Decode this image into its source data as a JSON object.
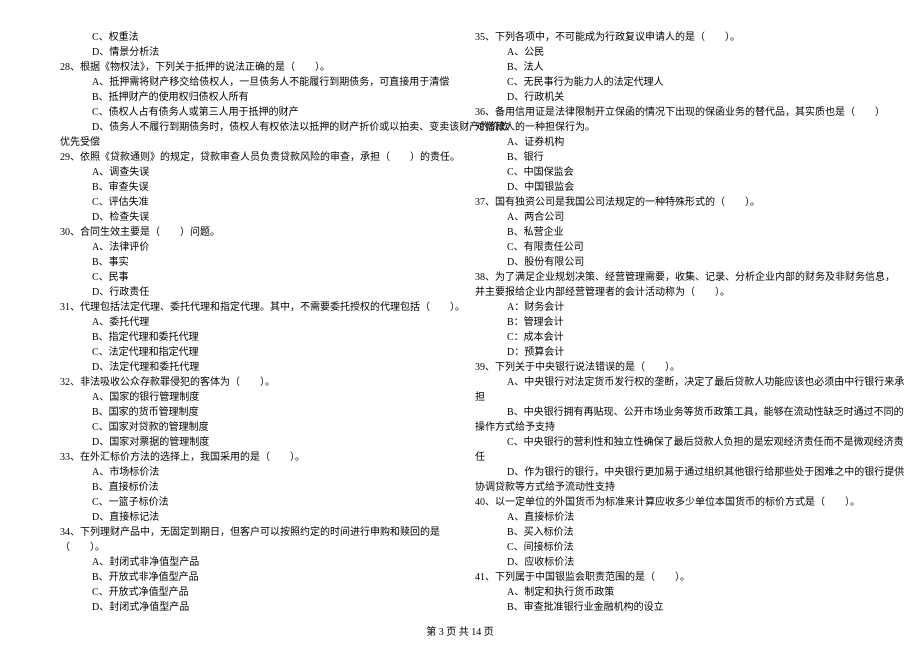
{
  "footer": "第 3 页 共 14 页",
  "left": {
    "q27c": "C、权重法",
    "q27d": "D、情景分析法",
    "q28": "28、根据《物权法》，下列关于抵押的说法正确的是（　　）。",
    "q28a": "A、抵押需将财产移交给债权人，一旦债务人不能履行到期债务，可直接用于清偿",
    "q28b": "B、抵押财产的使用权归债权人所有",
    "q28c": "C、债权人占有债务人或第三人用于抵押的财产",
    "q28d1": "D、债务人不履行到期债务时，债权人有权依法以抵押的财产折价或以拍卖、变卖该财产的价款",
    "q28d2": "优先受偿",
    "q29": "29、依照《贷款通则》的规定，贷款审查人员负责贷款风险的审查，承担（　　）的责任。",
    "q29a": "A、调查失误",
    "q29b": "B、审查失误",
    "q29c": "C、评估失准",
    "q29d": "D、检查失误",
    "q30": "30、合同生效主要是（　　）问题。",
    "q30a": "A、法律评价",
    "q30b": "B、事实",
    "q30c": "C、民事",
    "q30d": "D、行政责任",
    "q31": "31、代理包括法定代理、委托代理和指定代理。其中，不需要委托授权的代理包括（　　）。",
    "q31a": "A、委托代理",
    "q31b": "B、指定代理和委托代理",
    "q31c": "C、法定代理和指定代理",
    "q31d": "D、法定代理和委托代理",
    "q32": "32、非法吸收公众存款罪侵犯的客体为（　　）。",
    "q32a": "A、国家的银行管理制度",
    "q32b": "B、国家的货币管理制度",
    "q32c": "C、国家对贷款的管理制度",
    "q32d": "D、国家对票据的管理制度",
    "q33": "33、在外汇标价方法的选择上，我国采用的是（　　）。",
    "q33a": "A、市场标价法",
    "q33b": "B、直接标价法",
    "q33c": "C、一篮子标价法",
    "q33d": "D、直接标记法",
    "q34_1": "34、下列理财产品中，无固定到期日，但客户可以按照约定的时间进行申购和赎回的是",
    "q34_2": "（　　）。",
    "q34a": "A、封闭式非净值型产品",
    "q34b": "B、开放式非净值型产品",
    "q34c": "C、开放式净值型产品",
    "q34d": "D、封闭式净值型产品"
  },
  "right": {
    "q35": "35、下列各项中，不可能成为行政复议申请人的是（　　）。",
    "q35a": "A、公民",
    "q35b": "B、法人",
    "q35c": "C、无民事行为能力人的法定代理人",
    "q35d": "D、行政机关",
    "q36_1": "36、备用信用证是法律限制开立保函的情况下出现的保函业务的替代品，其实质也是（　　）",
    "q36_2": "对借款人的一种担保行为。",
    "q36a": "A、证券机构",
    "q36b": "B、银行",
    "q36c": "C、中国保监会",
    "q36d": "D、中国银监会",
    "q37": "37、国有独资公司是我国公司法规定的一种特殊形式的（　　）。",
    "q37a": "A、两合公司",
    "q37b": "B、私营企业",
    "q37c": "C、有限责任公司",
    "q37d": "D、股份有限公司",
    "q38_1": "38、为了满足企业规划决策、经营管理需要，收集、记录、分析企业内部的财务及非财务信息，",
    "q38_2": "并主要报给企业内部经营管理者的会计活动称为（　　）。",
    "q38a": "A：财务会计",
    "q38b": "B：管理会计",
    "q38c": "C：成本会计",
    "q38d": "D：预算会计",
    "q39": "39、下列关于中央银行说法错误的是（　　）。",
    "q39a1": "A、中央银行对法定货币发行权的垄断，决定了最后贷款人功能应该也必须由中行银行来承",
    "q39a2": "担",
    "q39b1": "B、中央银行拥有再贴现、公开市场业务等货币政策工具，能够在流动性缺乏时通过不同的",
    "q39b2": "操作方式给予支持",
    "q39c1": "C、中央银行的营利性和独立性确保了最后贷款人负担的是宏观经济责任而不是微观经济责",
    "q39c2": "任",
    "q39d1": "D、作为银行的银行，中央银行更加易于通过组织其他银行给那些处于困难之中的银行提供",
    "q39d2": "协调贷款等方式给予流动性支持",
    "q40": "40、以一定单位的外国货币为标准来计算应收多少单位本国货币的标价方式是（　　）。",
    "q40a": "A、直接标价法",
    "q40b": "B、买入标价法",
    "q40c": "C、间接标价法",
    "q40d": "D、应收标价法",
    "q41": "41、下列属于中国银监会职责范围的是（　　）。",
    "q41a": "A、制定和执行货币政策",
    "q41b": "B、审查批准银行业金融机构的设立"
  }
}
